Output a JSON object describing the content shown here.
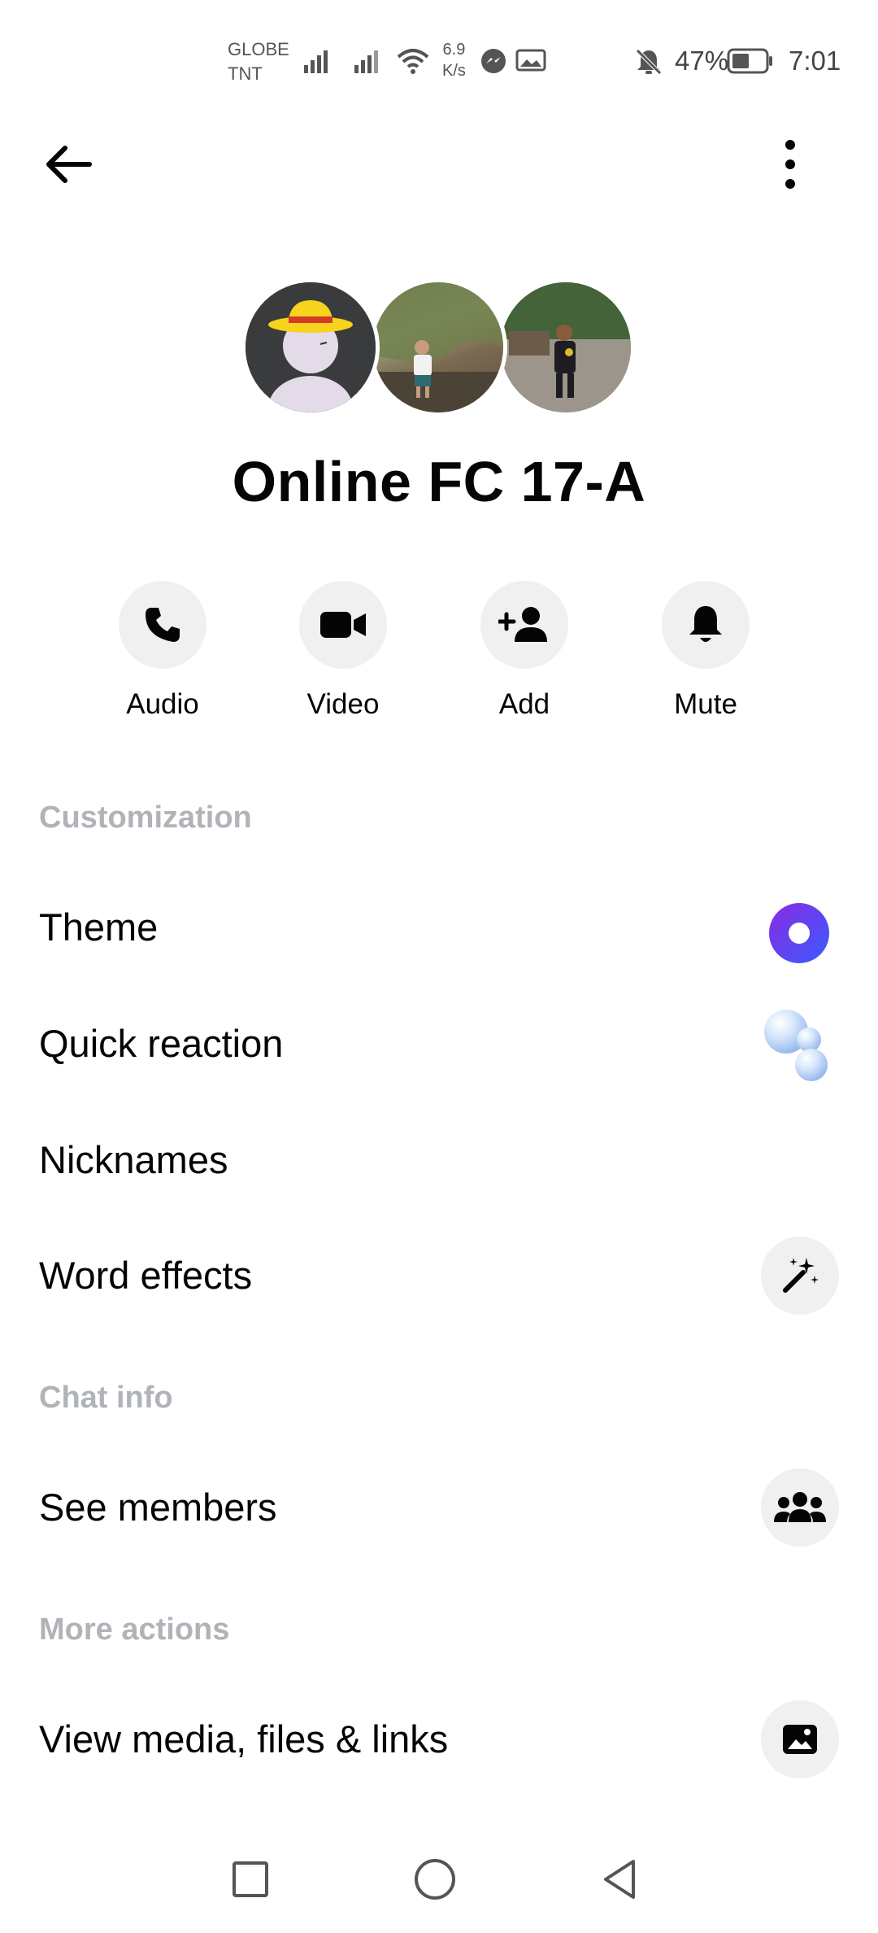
{
  "status_bar": {
    "carrier_1": "GLOBE",
    "carrier_2": "TNT",
    "speed_value": "6.9",
    "speed_unit": "K/s",
    "battery": "47%",
    "time": "7:01"
  },
  "header": {
    "back_icon": "arrow-left-icon",
    "more_icon": "vertical-dots-icon"
  },
  "group": {
    "name": "Online FC 17-A"
  },
  "actions": [
    {
      "label": "Audio",
      "icon": "phone-icon"
    },
    {
      "label": "Video",
      "icon": "video-camera-icon"
    },
    {
      "label": "Add",
      "icon": "add-person-icon"
    },
    {
      "label": "Mute",
      "icon": "bell-icon"
    }
  ],
  "sections": {
    "customization": {
      "title": "Customization",
      "rows": [
        {
          "label": "Theme",
          "icon": "theme-dot-icon"
        },
        {
          "label": "Quick reaction",
          "icon": "bubbles-icon"
        },
        {
          "label": "Nicknames"
        },
        {
          "label": "Word effects",
          "icon": "magic-wand-icon"
        }
      ]
    },
    "chat_info": {
      "title": "Chat info",
      "rows": [
        {
          "label": "See members",
          "icon": "members-icon"
        }
      ]
    },
    "more_actions": {
      "title": "More actions",
      "rows": [
        {
          "label": "View media, files & links",
          "icon": "image-icon"
        }
      ]
    }
  },
  "colors": {
    "section_header": "#b0b3b8",
    "icon_bg": "#f0f0f0",
    "theme_gradient_start": "#8a2be2",
    "theme_gradient_end": "#3b5bff"
  },
  "nav_bar": {
    "icons": [
      "recents-square-icon",
      "home-circle-icon",
      "back-triangle-icon"
    ]
  }
}
